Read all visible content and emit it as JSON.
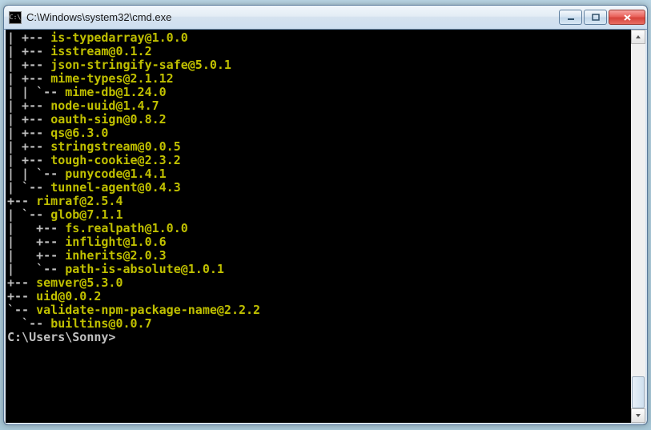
{
  "window": {
    "icon_label": "C:\\",
    "title": "C:\\Windows\\system32\\cmd.exe"
  },
  "controls": {
    "minimize": "minimize-button",
    "maximize": "maximize-button",
    "close": "close-button"
  },
  "terminal": {
    "lines": [
      "| +-- is-typedarray@1.0.0",
      "| +-- isstream@0.1.2",
      "| +-- json-stringify-safe@5.0.1",
      "| +-- mime-types@2.1.12",
      "| | `-- mime-db@1.24.0",
      "| +-- node-uuid@1.4.7",
      "| +-- oauth-sign@0.8.2",
      "| +-- qs@6.3.0",
      "| +-- stringstream@0.0.5",
      "| +-- tough-cookie@2.3.2",
      "| | `-- punycode@1.4.1",
      "| `-- tunnel-agent@0.4.3",
      "+-- rimraf@2.5.4",
      "| `-- glob@7.1.1",
      "|   +-- fs.realpath@1.0.0",
      "|   +-- inflight@1.0.6",
      "|   +-- inherits@2.0.3",
      "|   `-- path-is-absolute@1.0.1",
      "+-- semver@5.3.0",
      "+-- uid@0.0.2",
      "`-- validate-npm-package-name@2.2.2",
      "  `-- builtins@0.0.7",
      "",
      ""
    ],
    "prompt": "C:\\Users\\Sonny>"
  }
}
